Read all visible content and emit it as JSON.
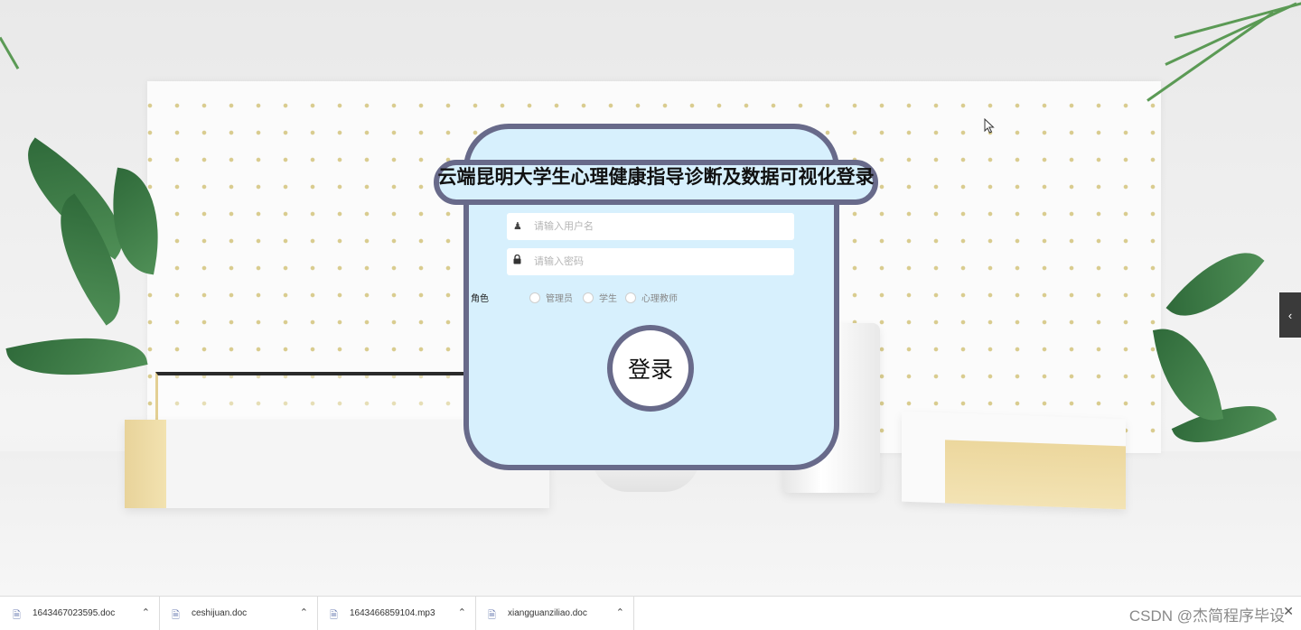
{
  "login": {
    "title": "云端昆明大学生心理健康指导诊断及数据可视化登录",
    "username_placeholder": "请输入用户名",
    "password_placeholder": "请输入密码",
    "role_label": "角色",
    "roles": [
      "管理员",
      "学生",
      "心理教师"
    ],
    "submit_label": "登录"
  },
  "side_tab": {
    "icon": "chevron-left-icon",
    "glyph": "‹"
  },
  "downloads": {
    "items": [
      {
        "name": "1643467023595.doc",
        "icon": "document-icon"
      },
      {
        "name": "ceshijuan.doc",
        "icon": "document-icon"
      },
      {
        "name": "1643466859104.mp3",
        "icon": "audio-file-icon"
      },
      {
        "name": "xiangguanziliao.doc",
        "icon": "document-icon"
      }
    ],
    "watermark": "CSDN @杰简程序毕设"
  },
  "colors": {
    "card_bg": "#d7f0fd",
    "card_border": "#686a8a"
  }
}
